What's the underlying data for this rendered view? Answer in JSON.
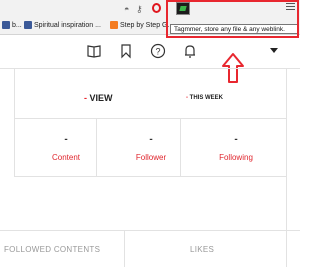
{
  "browser": {
    "bookmarks": [
      {
        "label": "b...",
        "color": "#3b5998"
      },
      {
        "label": "Spiritual inspiration ...",
        "color": "#3b5998"
      },
      {
        "label": "Step by Step G...",
        "color": "#f47b20"
      }
    ],
    "extension_tooltip": "Tagmmer, store any file & any weblink.",
    "extension_name": "Tagmmer",
    "highlight_color": "#e8272f"
  },
  "profile": {
    "view_label": "VIEW",
    "view_dash": "-",
    "this_week_label": "THIS WEEK",
    "this_week_dash": "-",
    "stats": [
      {
        "value": "-",
        "label": "Content"
      },
      {
        "value": "-",
        "label": "Follower"
      },
      {
        "value": "-",
        "label": "Following"
      }
    ],
    "tabs": [
      {
        "label": "FOLLOWED CONTENTS"
      },
      {
        "label": "LIKES"
      }
    ]
  }
}
